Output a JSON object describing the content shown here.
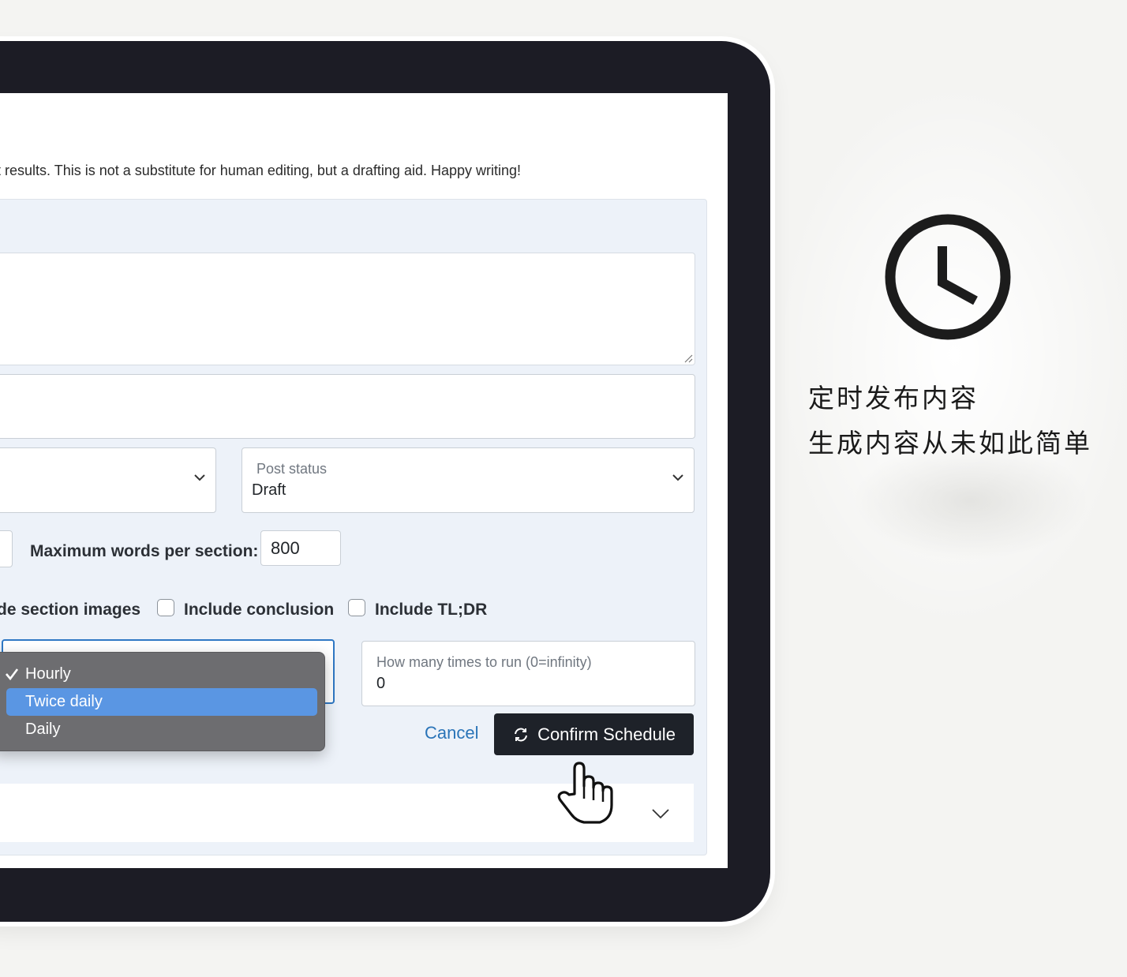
{
  "intro_text": "t results. This is not a substitute for human editing, but a drafting aid. Happy writing!",
  "post_status": {
    "label": "Post status",
    "value": "Draft"
  },
  "max_words": {
    "label": "Maximum words per section:",
    "value": "800"
  },
  "checkboxes": {
    "section_images": "de section images",
    "conclusion": "Include conclusion",
    "tldr": "Include TL;DR"
  },
  "frequency_menu": {
    "selected": "Hourly",
    "highlighted": "Twice daily",
    "items": [
      "Hourly",
      "Twice daily",
      "Daily"
    ]
  },
  "run_times": {
    "label": "How many times to run (0=infinity)",
    "value": "0"
  },
  "actions": {
    "cancel": "Cancel",
    "confirm": "Confirm Schedule"
  },
  "promo": {
    "line1": "定时发布内容",
    "line2": "生成内容从未如此简单"
  },
  "icons": {
    "clock": "clock-icon",
    "refresh": "refresh-icon",
    "cursor": "hand-pointer-icon",
    "check": "check-icon",
    "chevron": "chevron-down-icon"
  },
  "colors": {
    "frame": "#1c1c25",
    "accent": "#2f78c4",
    "highlight": "#5a96e3",
    "button": "#1e2229"
  }
}
